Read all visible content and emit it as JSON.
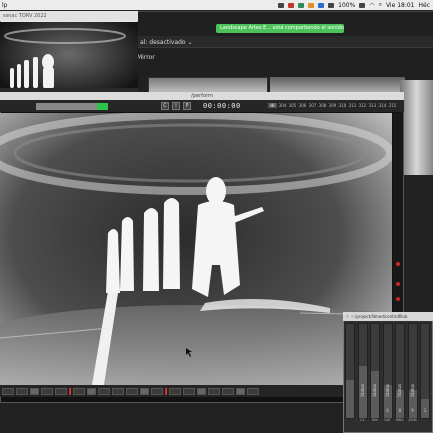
{
  "menubar": {
    "app_name": "lp",
    "battery": "100%",
    "clock": "Vie 18:01",
    "user": "Héc"
  },
  "back_window": {
    "share_banner": "Landscape Artes E... está compartiendo el sonido de",
    "stream_status": "al: desactivado",
    "mirror_label": "Mirror"
  },
  "topleft_window": {
    "title": "ssnac TORV 2022"
  },
  "main_window": {
    "title": "/perform",
    "buttons": [
      "C",
      "I",
      "P"
    ],
    "timer": "00:00:00",
    "frame_numbers": [
      "HI",
      "304",
      "305",
      "306",
      "307",
      "308",
      "309",
      "310",
      "311",
      "312",
      "313",
      "314",
      "315"
    ],
    "meter_level": 0.85
  },
  "mixer_window": {
    "title": "/project/lilmedicontrolfilob",
    "channels": [
      {
        "label": "",
        "num": "",
        "name": "",
        "fill": 0.4
      },
      {
        "label": "Status",
        "num": "",
        "name": "C1",
        "fill": 0.55
      },
      {
        "label": "Status",
        "num": "",
        "name": "INV",
        "fill": 0.5
      },
      {
        "label": "Status",
        "num": "6",
        "name": "SAT",
        "fill": 0.35
      },
      {
        "label": "Status",
        "num": "8",
        "name": "BRG",
        "fill": 0.3
      },
      {
        "label": "Status",
        "num": "9",
        "name": "ZOM",
        "fill": 0.3
      },
      {
        "label": "",
        "num": "1",
        "name": "",
        "fill": 0.2
      }
    ]
  },
  "colors": {
    "share_banner": "#4cc35a",
    "meter_green": "#2ec34a",
    "record_red": "#c62828"
  }
}
